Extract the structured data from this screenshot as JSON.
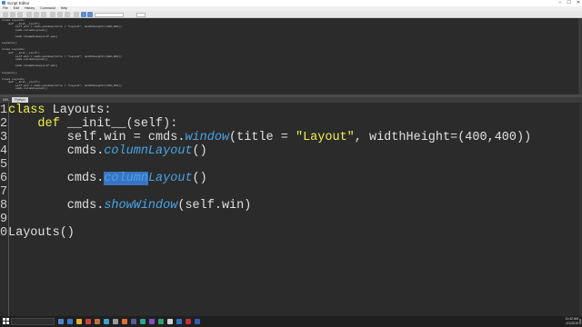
{
  "window": {
    "title": "Script Editor",
    "controls": [
      "–",
      "☐",
      "✕"
    ]
  },
  "menu": [
    "File",
    "Edit",
    "History",
    "Command",
    "Help"
  ],
  "output_lines": [
    "class Layouts:",
    "    def __init__(self):",
    "        self.win = cmds.window(title = \"Layout\", widthHeight=(400,400))",
    "        cmds.columnLayout()",
    "",
    "        cmds.showWindow(self.win)",
    "",
    "Layouts()",
    "",
    "class Layouts:",
    "    def __init__(self):",
    "        self.win = cmds.window(title = \"Layout\", widthHeight=(400,400))",
    "        cmds.columnLayout()",
    "",
    "        cmds.showWindow(self.win)",
    "",
    "Layouts()",
    "",
    "class Layouts:",
    "    def __init__(self):",
    "        self.win = cmds.window(title = \"Layout\", widthHeight=(400,400))",
    "        cmds.columnLayout()",
    "",
    "        cmds.showWindow(self.win)",
    "",
    "Layouts()"
  ],
  "tabs": [
    "MEL",
    "Python"
  ],
  "active_tab": 1,
  "editor": {
    "line_numbers": [
      "1",
      "2",
      "3",
      "4",
      "5",
      "6",
      "7",
      "8",
      "9",
      "0"
    ],
    "code": [
      {
        "segments": [
          {
            "t": "class",
            "c": "kw"
          },
          {
            "t": " Layouts:",
            "c": ""
          }
        ]
      },
      {
        "segments": [
          {
            "t": "    ",
            "c": ""
          },
          {
            "t": "def",
            "c": "kw"
          },
          {
            "t": " __init__(self):",
            "c": ""
          }
        ]
      },
      {
        "segments": [
          {
            "t": "        self.win = cmds.",
            "c": ""
          },
          {
            "t": "window",
            "c": "fn"
          },
          {
            "t": "(title = ",
            "c": ""
          },
          {
            "t": "\"Layout\"",
            "c": "str"
          },
          {
            "t": ", widthHeight=(400,400))",
            "c": ""
          }
        ]
      },
      {
        "segments": [
          {
            "t": "        cmds.",
            "c": ""
          },
          {
            "t": "columnLayout",
            "c": "fn"
          },
          {
            "t": "()",
            "c": ""
          }
        ]
      },
      {
        "segments": []
      },
      {
        "segments": [
          {
            "t": "        cmds.",
            "c": ""
          },
          {
            "t": "column",
            "c": "fn sel"
          },
          {
            "t": "Layout",
            "c": "fn"
          },
          {
            "t": "()",
            "c": ""
          }
        ]
      },
      {
        "segments": []
      },
      {
        "segments": [
          {
            "t": "        cmds.",
            "c": ""
          },
          {
            "t": "showWindow",
            "c": "fn"
          },
          {
            "t": "(self.win)",
            "c": ""
          }
        ]
      },
      {
        "segments": []
      },
      {
        "segments": [
          {
            "t": "Layouts()",
            "c": ""
          }
        ]
      }
    ]
  },
  "taskbar": {
    "clock_time": "11:42 AM",
    "clock_date": "2/1/2019"
  },
  "colors": {
    "keyword": "#f2f24c",
    "function": "#49a3e6",
    "selection": "#3874c2",
    "background": "#2b2b2b"
  }
}
